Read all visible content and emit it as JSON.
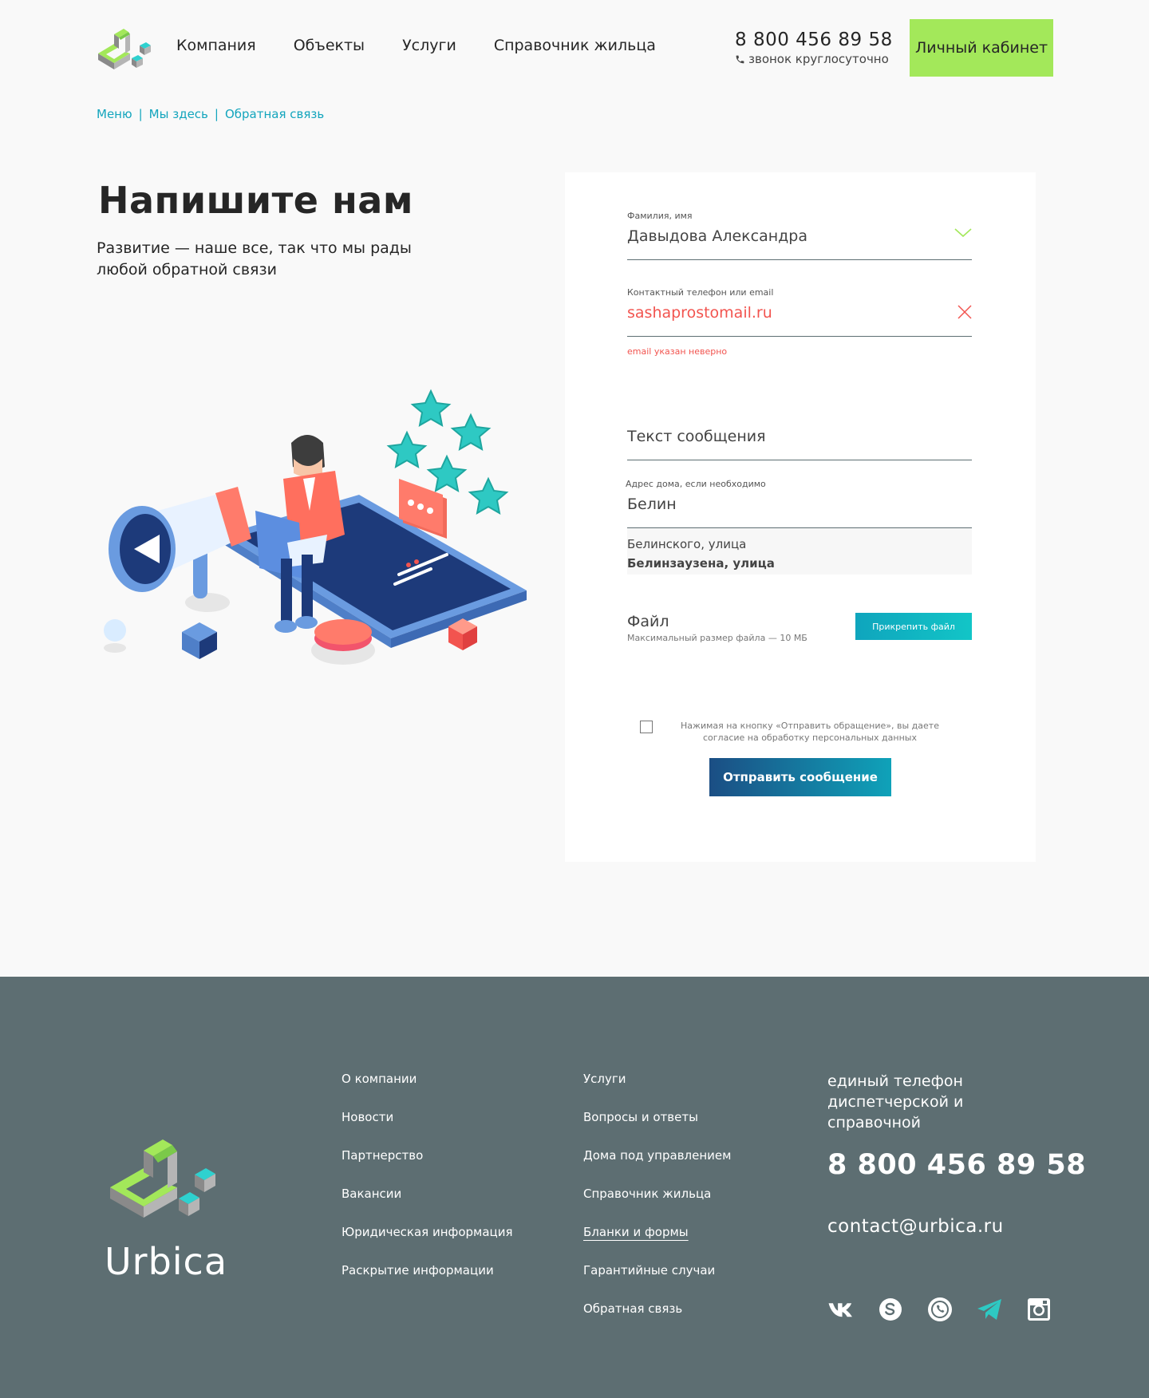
{
  "header": {
    "nav": [
      "Компания",
      "Объекты",
      "Услуги",
      "Справочник жильца"
    ],
    "phone": "8 800 456 89 58",
    "phone_sub": "звонок круглосуточно",
    "cabinet_label": "Личный кабинет"
  },
  "breadcrumb": [
    "Меню",
    "Мы здесь",
    "Обратная связь"
  ],
  "intro": {
    "title": "Напишите нам",
    "lead": "Развитие — наше все, так что мы рады любой обратной связи"
  },
  "form": {
    "name_label": "Фамилия, имя",
    "name_value": "Давыдова Александра",
    "contact_label": "Контактный телефон или email",
    "contact_value": "sashaprostomail.ru",
    "contact_error": "email указан неверно",
    "message_placeholder": "Текст сообщения",
    "address_label": "Адрес дома, если необходимо",
    "address_value": "Белин",
    "suggestions": [
      "Белинского, улица",
      "Белинзаузена, улица"
    ],
    "file_label": "Файл",
    "file_sub": "Максимальный размер файла — 10 МБ",
    "attach_label": "Прикрепить файл",
    "consent": "Нажимая на кнопку «Отправить обращение», вы даете согласие на обработку персональных данных",
    "submit_label": "Отправить сообщение"
  },
  "footer": {
    "brand": "Urbica",
    "col1": [
      "О компании",
      "Новости",
      "Партнерство",
      "Вакансии",
      "Юридическая информация",
      "Раскрытие информации"
    ],
    "col2": [
      "Услуги",
      "Вопросы и ответы",
      "Дома под управлением",
      "Справочник жильца",
      "Бланки и формы",
      "Гарантийные случаи",
      "Обратная связь"
    ],
    "contact_title": "единый телефон диспетчерской и справочной",
    "phone": "8 800 456 89 58",
    "email": "contact@urbica.ru",
    "socials": [
      "vk-icon",
      "skype-icon",
      "whatsapp-icon",
      "telegram-icon",
      "instagram-icon"
    ]
  },
  "colors": {
    "accent_green": "#a3e85a",
    "accent_teal": "#13a5bd",
    "error": "#f2544f",
    "footer_bg": "#5d6e72",
    "navy": "#1b4e84"
  }
}
